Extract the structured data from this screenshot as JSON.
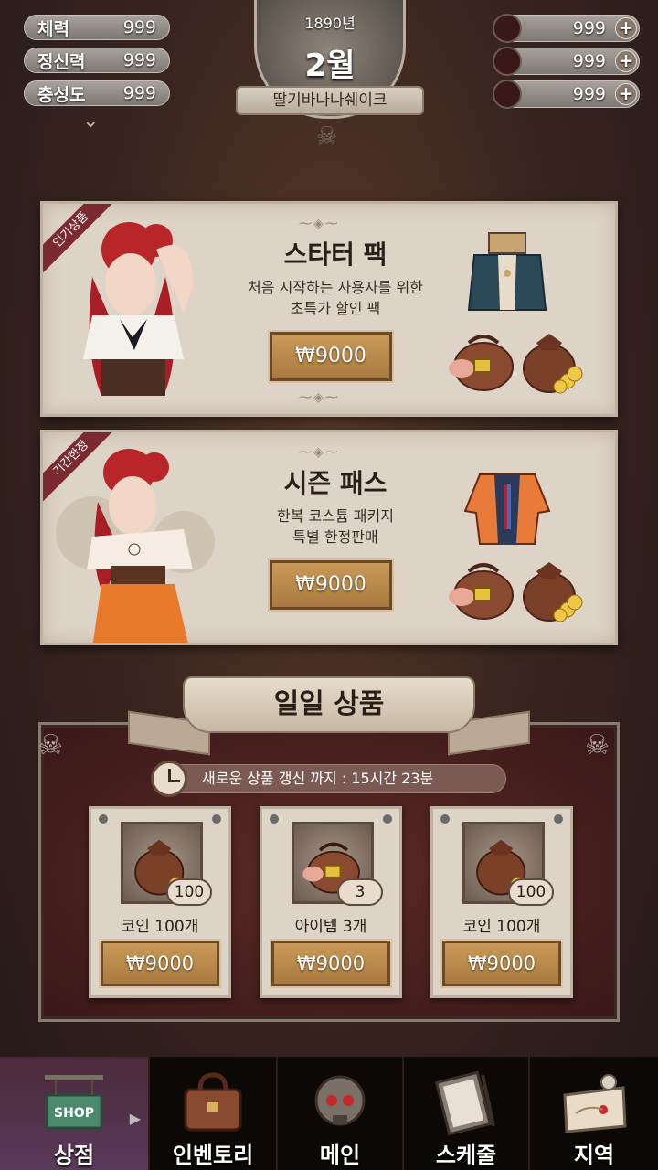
{
  "stats": [
    {
      "label": "체력",
      "value": "999"
    },
    {
      "label": "정신력",
      "value": "999"
    },
    {
      "label": "충성도",
      "value": "999"
    }
  ],
  "currencies": [
    {
      "value": "999"
    },
    {
      "value": "999"
    },
    {
      "value": "999"
    }
  ],
  "date": {
    "year": "1890년",
    "month": "2월",
    "name": "딸기바나나쉐이크"
  },
  "promos": [
    {
      "ribbon": "인기상품",
      "title": "스타터 팩",
      "desc1": "처음 시작하는 사용자를 위한",
      "desc2": "초특가 할인 팩",
      "price": "₩9000"
    },
    {
      "ribbon": "기간한정",
      "title": "시즌 패스",
      "desc1": "한복 코스튬 패키지",
      "desc2": "특별 한정판매",
      "price": "₩9000"
    }
  ],
  "daily": {
    "title": "일일 상품",
    "timer": "새로운 상품 갱신 까지 : 15시간 23분",
    "items": [
      {
        "qty": "100",
        "name": "코인 100개",
        "price": "₩9000"
      },
      {
        "qty": "3",
        "name": "아이템 3개",
        "price": "₩9000"
      },
      {
        "qty": "100",
        "name": "코인 100개",
        "price": "₩9000"
      }
    ]
  },
  "nav": [
    {
      "label": "상점",
      "icon": "shop-sign-icon"
    },
    {
      "label": "인벤토리",
      "icon": "bag-icon"
    },
    {
      "label": "메인",
      "icon": "skull-icon"
    },
    {
      "label": "스케줄",
      "icon": "clipboard-icon"
    },
    {
      "label": "지역",
      "icon": "map-icon"
    }
  ],
  "colors": {
    "accent": "#b8884a",
    "card": "#ddd3c6",
    "ribbon": "#7a2a30",
    "nav_active": "#5a3a5a"
  }
}
